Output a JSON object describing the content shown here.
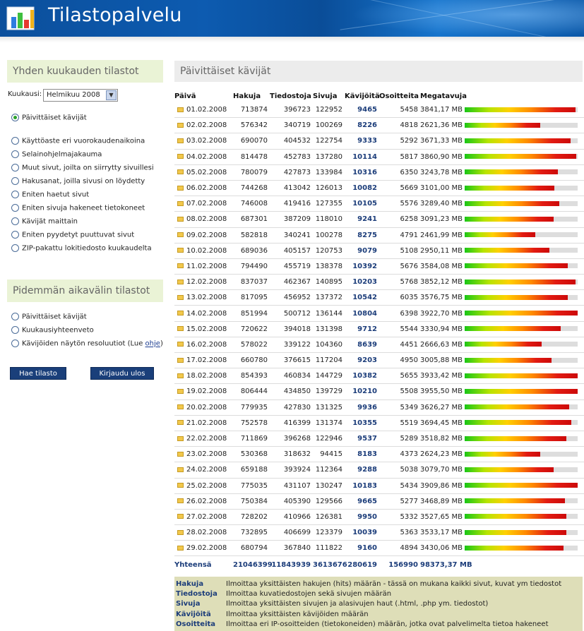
{
  "header": {
    "title": "Tilastopalvelu",
    "logo_icon": "chart-logo-icon"
  },
  "sidebar": {
    "monthly_title": "Yhden kuukauden tilastot",
    "month_label": "Kuukausi:",
    "month_value": "Helmikuu 2008",
    "monthly_options": [
      "Päivittäiset kävijät",
      "Käyttöaste eri vuorokaudenaikoina",
      "Selainohjelmajakauma",
      "Muut sivut, joilta on siirrytty sivuillesi",
      "Hakusanat, joilla sivusi on löydetty",
      "Eniten haetut sivut",
      "Eniten sivuja hakeneet tietokoneet",
      "Kävijät maittain",
      "Eniten pyydetyt puuttuvat sivut",
      "ZIP-pakattu lokitiedosto kuukaudelta"
    ],
    "selected_index": 0,
    "longer_title": "Pidemmän aikavälin tilastot",
    "longer_options": [
      "Päivittäiset kävijät",
      "Kuukausiyhteenveto",
      "Kävijöiden näytön resoluutiot (Lue "
    ],
    "help_link": "ohje",
    "help_suffix": ")",
    "fetch_button": "Hae tilasto",
    "logout_button": "Kirjaudu ulos"
  },
  "main": {
    "title": "Päivittäiset kävijät",
    "columns": [
      "Päivä",
      "Hakuja",
      "Tiedostoja",
      "Sivuja",
      "Kävijöitä",
      "Osoitteita",
      "Megatavuja"
    ],
    "max_mb": 3922.7,
    "rows": [
      {
        "date": "01.02.2008",
        "hits": "713874",
        "files": "396723",
        "pages": "122952",
        "visitors": "9465",
        "ips": "5458",
        "mb": "3841,17 MB",
        "mb_value": 3841.17
      },
      {
        "date": "02.02.2008",
        "hits": "576342",
        "files": "340719",
        "pages": "100269",
        "visitors": "8226",
        "ips": "4818",
        "mb": "2621,36 MB",
        "mb_value": 2621.36
      },
      {
        "date": "03.02.2008",
        "hits": "690070",
        "files": "404532",
        "pages": "122754",
        "visitors": "9333",
        "ips": "5292",
        "mb": "3671,33 MB",
        "mb_value": 3671.33
      },
      {
        "date": "04.02.2008",
        "hits": "814478",
        "files": "452783",
        "pages": "137280",
        "visitors": "10114",
        "ips": "5817",
        "mb": "3860,90 MB",
        "mb_value": 3860.9
      },
      {
        "date": "05.02.2008",
        "hits": "780079",
        "files": "427873",
        "pages": "133984",
        "visitors": "10316",
        "ips": "6350",
        "mb": "3243,78 MB",
        "mb_value": 3243.78
      },
      {
        "date": "06.02.2008",
        "hits": "744268",
        "files": "413042",
        "pages": "126013",
        "visitors": "10082",
        "ips": "5669",
        "mb": "3101,00 MB",
        "mb_value": 3101.0
      },
      {
        "date": "07.02.2008",
        "hits": "746008",
        "files": "419416",
        "pages": "127355",
        "visitors": "10105",
        "ips": "5576",
        "mb": "3289,40 MB",
        "mb_value": 3289.4
      },
      {
        "date": "08.02.2008",
        "hits": "687301",
        "files": "387209",
        "pages": "118010",
        "visitors": "9241",
        "ips": "6258",
        "mb": "3091,23 MB",
        "mb_value": 3091.23
      },
      {
        "date": "09.02.2008",
        "hits": "582818",
        "files": "340241",
        "pages": "100278",
        "visitors": "8275",
        "ips": "4791",
        "mb": "2461,99 MB",
        "mb_value": 2461.99
      },
      {
        "date": "10.02.2008",
        "hits": "689036",
        "files": "405157",
        "pages": "120753",
        "visitors": "9079",
        "ips": "5108",
        "mb": "2950,11 MB",
        "mb_value": 2950.11
      },
      {
        "date": "11.02.2008",
        "hits": "794490",
        "files": "455719",
        "pages": "138378",
        "visitors": "10392",
        "ips": "5676",
        "mb": "3584,08 MB",
        "mb_value": 3584.08
      },
      {
        "date": "12.02.2008",
        "hits": "837037",
        "files": "462367",
        "pages": "140895",
        "visitors": "10203",
        "ips": "5768",
        "mb": "3852,12 MB",
        "mb_value": 3852.12
      },
      {
        "date": "13.02.2008",
        "hits": "817095",
        "files": "456952",
        "pages": "137372",
        "visitors": "10542",
        "ips": "6035",
        "mb": "3576,75 MB",
        "mb_value": 3576.75
      },
      {
        "date": "14.02.2008",
        "hits": "851994",
        "files": "500712",
        "pages": "136144",
        "visitors": "10804",
        "ips": "6398",
        "mb": "3922,70 MB",
        "mb_value": 3922.7
      },
      {
        "date": "15.02.2008",
        "hits": "720622",
        "files": "394018",
        "pages": "131398",
        "visitors": "9712",
        "ips": "5544",
        "mb": "3330,94 MB",
        "mb_value": 3330.94
      },
      {
        "date": "16.02.2008",
        "hits": "578022",
        "files": "339122",
        "pages": "104360",
        "visitors": "8639",
        "ips": "4451",
        "mb": "2666,63 MB",
        "mb_value": 2666.63
      },
      {
        "date": "17.02.2008",
        "hits": "660780",
        "files": "376615",
        "pages": "117204",
        "visitors": "9203",
        "ips": "4950",
        "mb": "3005,88 MB",
        "mb_value": 3005.88
      },
      {
        "date": "18.02.2008",
        "hits": "854393",
        "files": "460834",
        "pages": "144729",
        "visitors": "10382",
        "ips": "5655",
        "mb": "3933,42 MB",
        "mb_value": 3933.42
      },
      {
        "date": "19.02.2008",
        "hits": "806444",
        "files": "434850",
        "pages": "139729",
        "visitors": "10210",
        "ips": "5508",
        "mb": "3955,50 MB",
        "mb_value": 3955.5
      },
      {
        "date": "20.02.2008",
        "hits": "779935",
        "files": "427830",
        "pages": "131325",
        "visitors": "9936",
        "ips": "5349",
        "mb": "3626,27 MB",
        "mb_value": 3626.27
      },
      {
        "date": "21.02.2008",
        "hits": "752578",
        "files": "416399",
        "pages": "131374",
        "visitors": "10355",
        "ips": "5519",
        "mb": "3694,45 MB",
        "mb_value": 3694.45
      },
      {
        "date": "22.02.2008",
        "hits": "711869",
        "files": "396268",
        "pages": "122946",
        "visitors": "9537",
        "ips": "5289",
        "mb": "3518,82 MB",
        "mb_value": 3518.82
      },
      {
        "date": "23.02.2008",
        "hits": "530368",
        "files": "318632",
        "pages": "94415",
        "visitors": "8183",
        "ips": "4373",
        "mb": "2624,23 MB",
        "mb_value": 2624.23
      },
      {
        "date": "24.02.2008",
        "hits": "659188",
        "files": "393924",
        "pages": "112364",
        "visitors": "9288",
        "ips": "5038",
        "mb": "3079,70 MB",
        "mb_value": 3079.7
      },
      {
        "date": "25.02.2008",
        "hits": "775035",
        "files": "431107",
        "pages": "130247",
        "visitors": "10183",
        "ips": "5434",
        "mb": "3909,86 MB",
        "mb_value": 3909.86
      },
      {
        "date": "26.02.2008",
        "hits": "750384",
        "files": "405390",
        "pages": "129566",
        "visitors": "9665",
        "ips": "5277",
        "mb": "3468,89 MB",
        "mb_value": 3468.89
      },
      {
        "date": "27.02.2008",
        "hits": "728202",
        "files": "410966",
        "pages": "126381",
        "visitors": "9950",
        "ips": "5332",
        "mb": "3527,65 MB",
        "mb_value": 3527.65
      },
      {
        "date": "28.02.2008",
        "hits": "732895",
        "files": "406699",
        "pages": "123379",
        "visitors": "10039",
        "ips": "5363",
        "mb": "3533,17 MB",
        "mb_value": 3533.17
      },
      {
        "date": "29.02.2008",
        "hits": "680794",
        "files": "367840",
        "pages": "111822",
        "visitors": "9160",
        "ips": "4894",
        "mb": "3430,06 MB",
        "mb_value": 3430.06
      }
    ],
    "total": {
      "label": "Yhteensä",
      "hits": "21046399",
      "files": "11843939",
      "pages": "3613676",
      "visitors": "280619",
      "ips": "156990",
      "mb": "98373,37 MB"
    }
  },
  "legend": [
    {
      "term": "Hakuja",
      "desc": "Ilmoittaa yksittäisten hakujen (hits) määrän - tässä on mukana kaikki sivut, kuvat ym tiedostot"
    },
    {
      "term": "Tiedostoja",
      "desc": "Ilmoittaa kuvatiedostojen sekä sivujen määrän"
    },
    {
      "term": "Sivuja",
      "desc": "Ilmoittaa yksittäisten sivujen ja alasivujen haut (.html, .php ym. tiedostot)"
    },
    {
      "term": "Kävijöitä",
      "desc": "Ilmoittaa yksittäisten kävijöiden määrän"
    },
    {
      "term": "Osoitteita",
      "desc": "Ilmoittaa eri IP-osoitteiden (tietokoneiden) määrän, jotka ovat palvelimelta tietoa hakeneet"
    }
  ],
  "colors": {
    "header_blue": "#0b4f9c",
    "panel_green": "#eaf3d6",
    "link_blue": "#1c3d7a",
    "legend_bg": "#dedeb8",
    "button_blue": "#1a3f7a"
  }
}
